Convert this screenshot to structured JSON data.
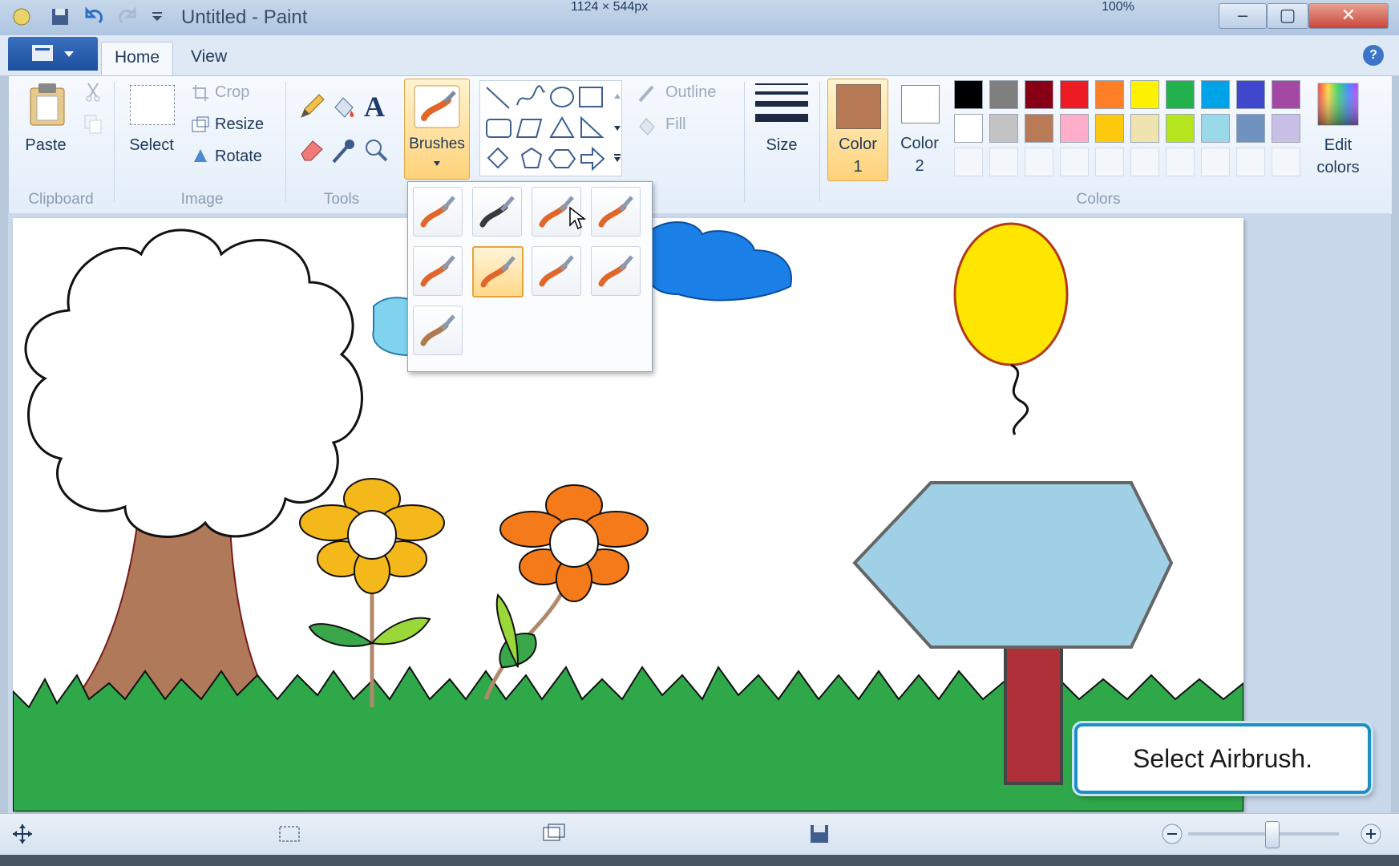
{
  "window": {
    "title": "Untitled - Paint"
  },
  "tabs": [
    {
      "label": "Home"
    },
    {
      "label": "View"
    }
  ],
  "clipboard": {
    "paste_label": "Paste",
    "group_label": "Clipboard"
  },
  "image": {
    "select_label": "Select",
    "crop_label": "Crop",
    "resize_label": "Resize",
    "rotate_label": "Rotate",
    "group_label": "Image"
  },
  "tools": {
    "group_label": "Tools",
    "text_tool": "A"
  },
  "brushes": {
    "label": "Brushes",
    "items_count_visible": 9,
    "selected_index": 5
  },
  "shapes": {
    "outline_label": "Outline",
    "fill_label": "Fill"
  },
  "size": {
    "label": "Size"
  },
  "colors": {
    "color1_label": "Color",
    "color1_num": "1",
    "color2_label": "Color",
    "color2_num": "2",
    "edit_label_1": "Edit",
    "edit_label_2": "colors",
    "group_label": "Colors",
    "color1": "#b87a55",
    "color2": "#ffffff",
    "palette_row1": [
      "#000000",
      "#7f7f7f",
      "#880015",
      "#ed1c24",
      "#ff7f27",
      "#fff200",
      "#22b14c",
      "#00a2e8",
      "#3f48cc",
      "#a349a4"
    ],
    "palette_row2": [
      "#ffffff",
      "#c3c3c3",
      "#b97a57",
      "#ffaec9",
      "#ffc90e",
      "#efe4b0",
      "#b5e61d",
      "#99d9ea",
      "#7092be",
      "#c8bfe7"
    ]
  },
  "status": {
    "dimensions": "1124 × 544px",
    "zoom": "100%"
  },
  "callout": {
    "text": "Select Airbrush."
  }
}
